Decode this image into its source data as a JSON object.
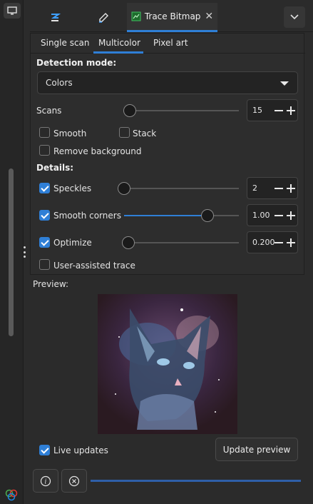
{
  "dock": {
    "tabs": [
      {
        "icon": "align-icon"
      },
      {
        "icon": "edit-pen-icon"
      },
      {
        "icon": "trace-bitmap-icon",
        "title": "Trace Bitmap",
        "close": "✕"
      }
    ]
  },
  "subtabs": [
    "Single scan",
    "Multicolor",
    "Pixel art"
  ],
  "detection": {
    "label": "Detection mode:",
    "value": "Colors"
  },
  "scans": {
    "label": "Scans",
    "value": "15",
    "level": 0.0
  },
  "checkboxes": {
    "smooth": {
      "label": "Smooth",
      "checked": false
    },
    "stack": {
      "label": "Stack",
      "checked": false
    },
    "remove_bg": {
      "label": "Remove background",
      "checked": false
    }
  },
  "details": {
    "label": "Details:",
    "speckles": {
      "label": "Speckles",
      "checked": true,
      "value": "2",
      "level": 0.0
    },
    "smooth_corners": {
      "label": "Smooth corners",
      "checked": true,
      "value": "1.00",
      "level": 0.73
    },
    "optimize": {
      "label": "Optimize",
      "checked": true,
      "value": "0.200",
      "level": 0.0
    }
  },
  "user_assisted": {
    "label": "User-assisted trace",
    "checked": false
  },
  "preview": {
    "label": "Preview:"
  },
  "live_updates": {
    "label": "Live updates",
    "checked": true
  },
  "update_preview": {
    "label": "Update preview"
  },
  "colors": {
    "accent": "#2f7fd6"
  }
}
